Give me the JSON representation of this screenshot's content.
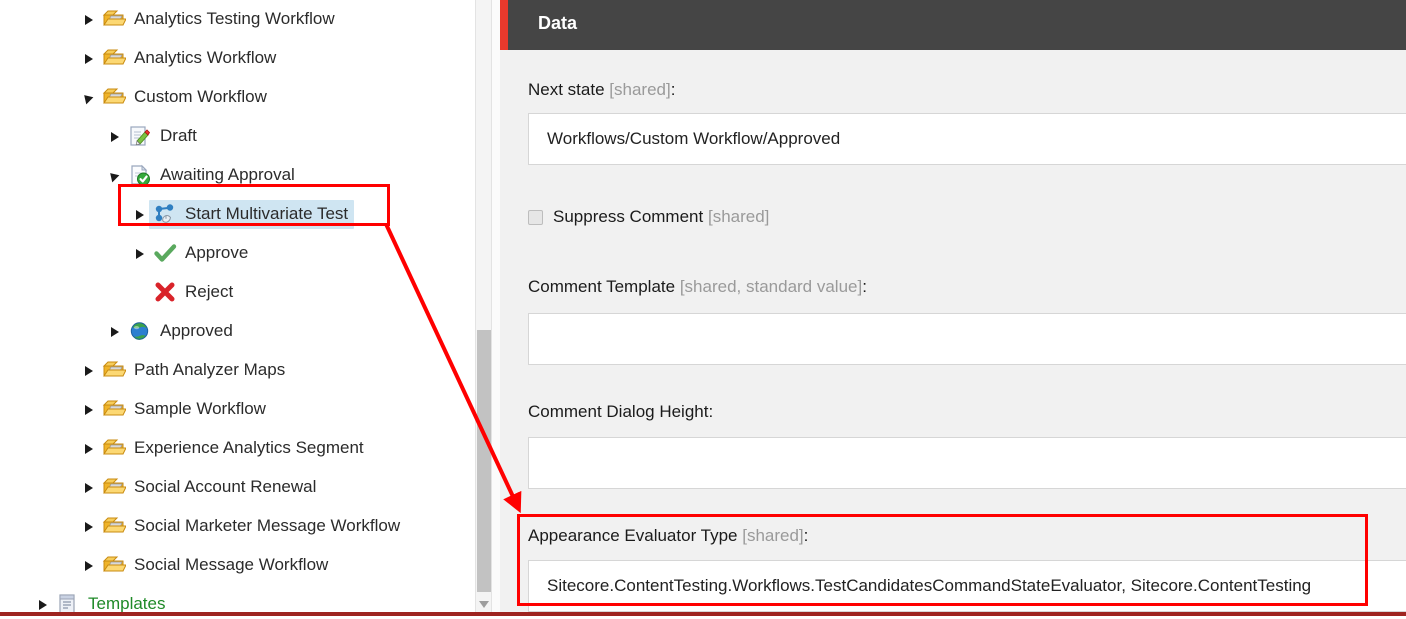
{
  "tree": {
    "items": [
      {
        "label": "Analytics Testing Workflow",
        "icon": "workflow-folder-icon",
        "twisty": "collapsed",
        "indent": 80,
        "selected": false,
        "green": false
      },
      {
        "label": "Analytics Workflow",
        "icon": "workflow-folder-icon",
        "twisty": "collapsed",
        "indent": 80,
        "selected": false,
        "green": false
      },
      {
        "label": "Custom Workflow",
        "icon": "workflow-folder-icon",
        "twisty": "expanded",
        "indent": 80,
        "selected": false,
        "green": false
      },
      {
        "label": "Draft",
        "icon": "draft-document-icon",
        "twisty": "collapsed",
        "indent": 106,
        "selected": false,
        "green": false
      },
      {
        "label": "Awaiting Approval",
        "icon": "awaiting-approval-icon",
        "twisty": "expanded",
        "indent": 106,
        "selected": false,
        "green": false
      },
      {
        "label": "Start Multivariate Test",
        "icon": "multivariate-test-icon",
        "twisty": "collapsed",
        "indent": 131,
        "selected": true,
        "green": false
      },
      {
        "label": "Approve",
        "icon": "check-icon",
        "twisty": "collapsed",
        "indent": 131,
        "selected": false,
        "green": false
      },
      {
        "label": "Reject",
        "icon": "reject-x-icon",
        "twisty": "none",
        "indent": 131,
        "selected": false,
        "green": false
      },
      {
        "label": "Approved",
        "icon": "globe-icon",
        "twisty": "collapsed",
        "indent": 106,
        "selected": false,
        "green": false
      },
      {
        "label": "Path Analyzer Maps",
        "icon": "workflow-folder-icon",
        "twisty": "collapsed",
        "indent": 80,
        "selected": false,
        "green": false
      },
      {
        "label": "Sample Workflow",
        "icon": "workflow-folder-icon",
        "twisty": "collapsed",
        "indent": 80,
        "selected": false,
        "green": false
      },
      {
        "label": "Experience Analytics Segment",
        "icon": "workflow-folder-icon",
        "twisty": "collapsed",
        "indent": 80,
        "selected": false,
        "green": false
      },
      {
        "label": "Social Account Renewal",
        "icon": "workflow-folder-icon",
        "twisty": "collapsed",
        "indent": 80,
        "selected": false,
        "green": false
      },
      {
        "label": "Social Marketer Message Workflow",
        "icon": "workflow-folder-icon",
        "twisty": "collapsed",
        "indent": 80,
        "selected": false,
        "green": false
      },
      {
        "label": "Social Message Workflow",
        "icon": "workflow-folder-icon",
        "twisty": "collapsed",
        "indent": 80,
        "selected": false,
        "green": false
      },
      {
        "label": "Templates",
        "icon": "templates-icon",
        "twisty": "collapsed",
        "indent": 34,
        "selected": false,
        "green": true
      }
    ]
  },
  "data_panel": {
    "header_title": "Data",
    "fields": [
      {
        "label": "Next state",
        "qualifier": "[shared]",
        "suffix": ":",
        "value": "Workflows/Custom Workflow/Approved",
        "type": "text"
      },
      {
        "label": "Suppress Comment",
        "qualifier": "[shared]",
        "suffix": "",
        "value": "",
        "type": "checkbox",
        "checked": false
      },
      {
        "label": "Comment Template",
        "qualifier": "[shared, standard value]",
        "suffix": ":",
        "value": "",
        "type": "text"
      },
      {
        "label": "Comment Dialog Height",
        "qualifier": "",
        "suffix": ":",
        "value": "",
        "type": "text"
      },
      {
        "label": "Appearance Evaluator Type",
        "qualifier": "[shared]",
        "suffix": ":",
        "value": "Sitecore.ContentTesting.Workflows.TestCandidatesCommandStateEvaluator, Sitecore.ContentTesting",
        "type": "text",
        "highlighted": true
      }
    ]
  },
  "annotations": {
    "accent_color": "#ff0000",
    "header_accent_color": "#e8392c",
    "selection_color": "#cfe5f2",
    "bottom_rule_color": "#9e2420"
  }
}
